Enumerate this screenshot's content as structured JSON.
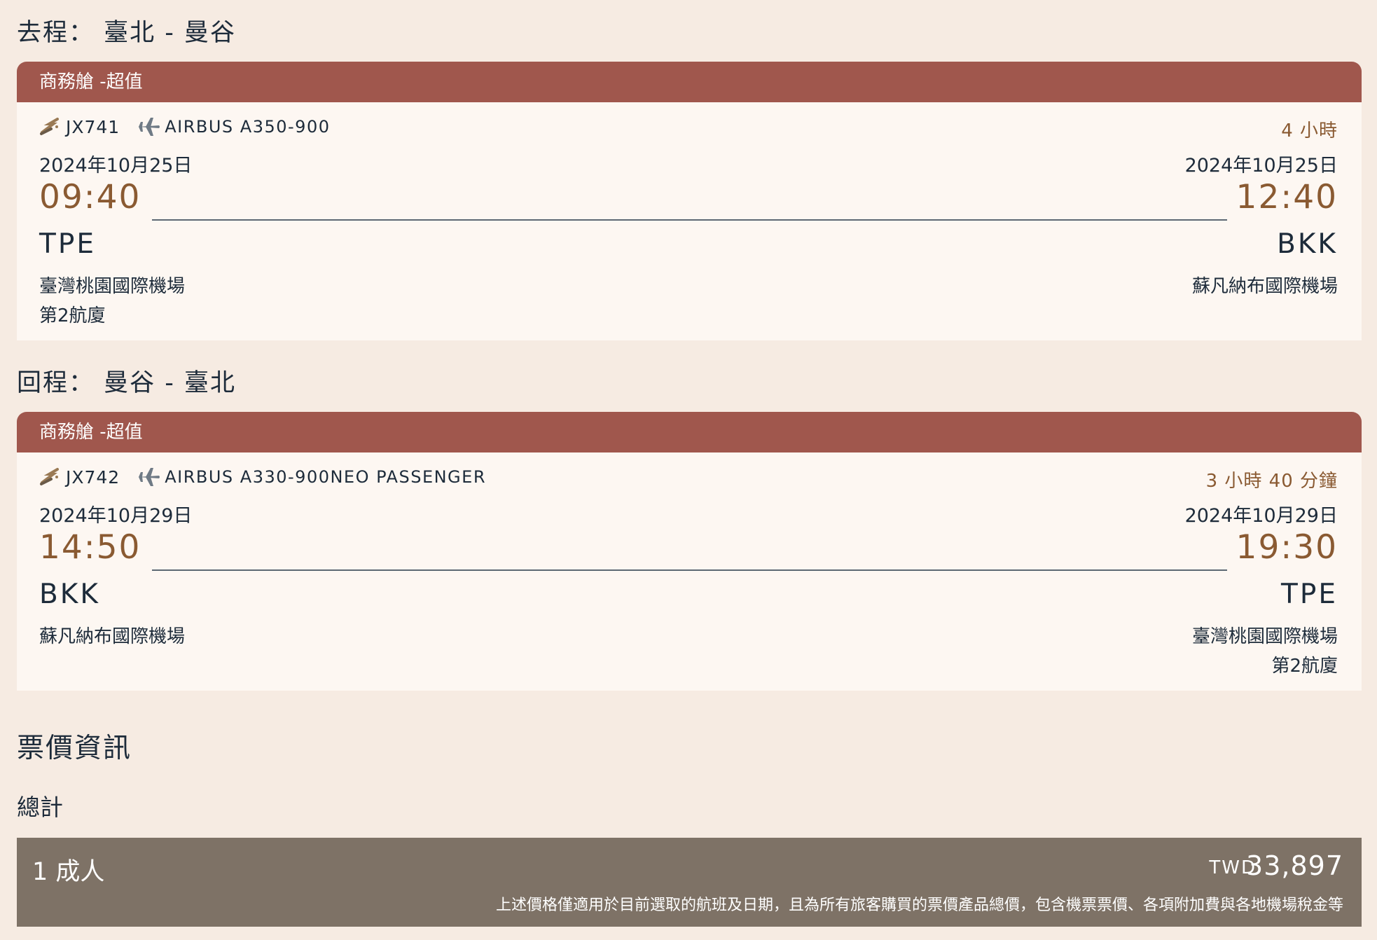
{
  "outbound": {
    "section_title": "去程： 臺北 - 曼谷",
    "cabin": "商務艙 -超值",
    "flight_no": "JX741",
    "aircraft": "AIRBUS A350-900",
    "duration": "4 小時",
    "depart": {
      "date": "2024年10月25日",
      "time": "09:40",
      "code": "TPE",
      "airport": "臺灣桃園國際機場",
      "terminal": "第2航廈"
    },
    "arrive": {
      "date": "2024年10月25日",
      "time": "12:40",
      "code": "BKK",
      "airport": "蘇凡納布國際機場",
      "terminal": ""
    }
  },
  "return": {
    "section_title": "回程： 曼谷 - 臺北",
    "cabin": "商務艙 -超值",
    "flight_no": "JX742",
    "aircraft": "AIRBUS A330-900NEO PASSENGER",
    "duration": "3 小時 40 分鐘",
    "depart": {
      "date": "2024年10月29日",
      "time": "14:50",
      "code": "BKK",
      "airport": "蘇凡納布國際機場",
      "terminal": ""
    },
    "arrive": {
      "date": "2024年10月29日",
      "time": "19:30",
      "code": "TPE",
      "airport": "臺灣桃園國際機場",
      "terminal": "第2航廈"
    }
  },
  "price": {
    "title": "票價資訊",
    "total_label": "總計",
    "passengers": "1 成人",
    "currency": "TWD",
    "amount": "33,897",
    "note": "上述價格僅適用於目前選取的航班及日期，且為所有旅客購買的票價產品總價，包含機票票價、各項附加費與各地機場稅金等"
  },
  "colors": {
    "background": "#f6ebe2",
    "card_header": "#a0574d",
    "card_body": "#fdf7f2",
    "time_accent": "#8a5a32",
    "total_box": "#7e7266"
  },
  "icons": {
    "airline_logo": "starlux-logo-icon",
    "aircraft": "airplane-icon"
  }
}
